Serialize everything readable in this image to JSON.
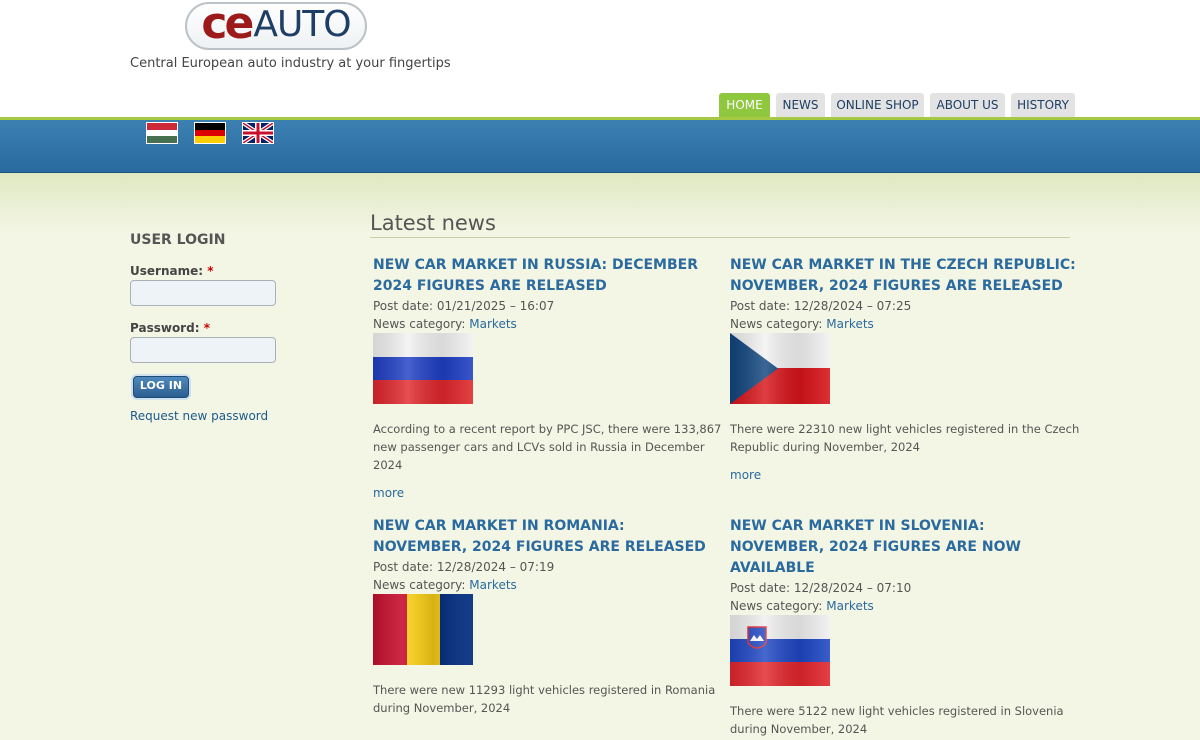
{
  "header": {
    "logo_ce": "ce",
    "logo_auto": "AUTO",
    "slogan": "Central European auto industry at your fingertips"
  },
  "nav": {
    "tabs": [
      {
        "label": "HOME",
        "active": true
      },
      {
        "label": "NEWS",
        "active": false
      },
      {
        "label": "ONLINE SHOP",
        "active": false
      },
      {
        "label": "ABOUT US",
        "active": false
      },
      {
        "label": "HISTORY",
        "active": false
      }
    ]
  },
  "languages": [
    {
      "icon": "hungarian-flag-icon"
    },
    {
      "icon": "german-flag-icon"
    },
    {
      "icon": "uk-flag-icon"
    }
  ],
  "login": {
    "title": "USER LOGIN",
    "username_label": "Username:",
    "password_label": "Password:",
    "required_mark": "*",
    "username_value": "",
    "password_value": "",
    "button_label": "LOG IN",
    "request_password": "Request new password"
  },
  "latest": {
    "title": "Latest news",
    "post_date_label": "Post date:",
    "category_label": "News category:",
    "more_label": "more",
    "items": [
      {
        "title": "NEW CAR MARKET IN RUSSIA: DECEMBER 2024 FIGURES ARE RELEASED",
        "date": "01/21/2025 – 16:07",
        "category": "Markets",
        "flag_icon": "russia-flag-icon",
        "text": "According to a recent report by PPC JSC, there were 133,867 new passenger cars and LCVs sold in Russia in December 2024"
      },
      {
        "title": "NEW CAR MARKET IN THE CZECH REPUBLIC: NOVEMBER, 2024 FIGURES ARE RELEASED",
        "date": "12/28/2024 – 07:25",
        "category": "Markets",
        "flag_icon": "czech-flag-icon",
        "text": "There were 22310 new light vehicles registered in the Czech Republic during November, 2024"
      },
      {
        "title": "NEW CAR MARKET IN ROMANIA: NOVEMBER, 2024 FIGURES ARE RELEASED",
        "date": "12/28/2024 – 07:19",
        "category": "Markets",
        "flag_icon": "romania-flag-icon",
        "text": "There were new 11293 light vehicles registered in Romania during November, 2024"
      },
      {
        "title": "NEW CAR MARKET IN SLOVENIA: NOVEMBER, 2024 FIGURES ARE NOW AVAILABLE",
        "date": "12/28/2024 – 07:10",
        "category": "Markets",
        "flag_icon": "slovenia-flag-icon",
        "text": "There were 5122 new light vehicles registered in Slovenia during November, 2024"
      }
    ]
  }
}
